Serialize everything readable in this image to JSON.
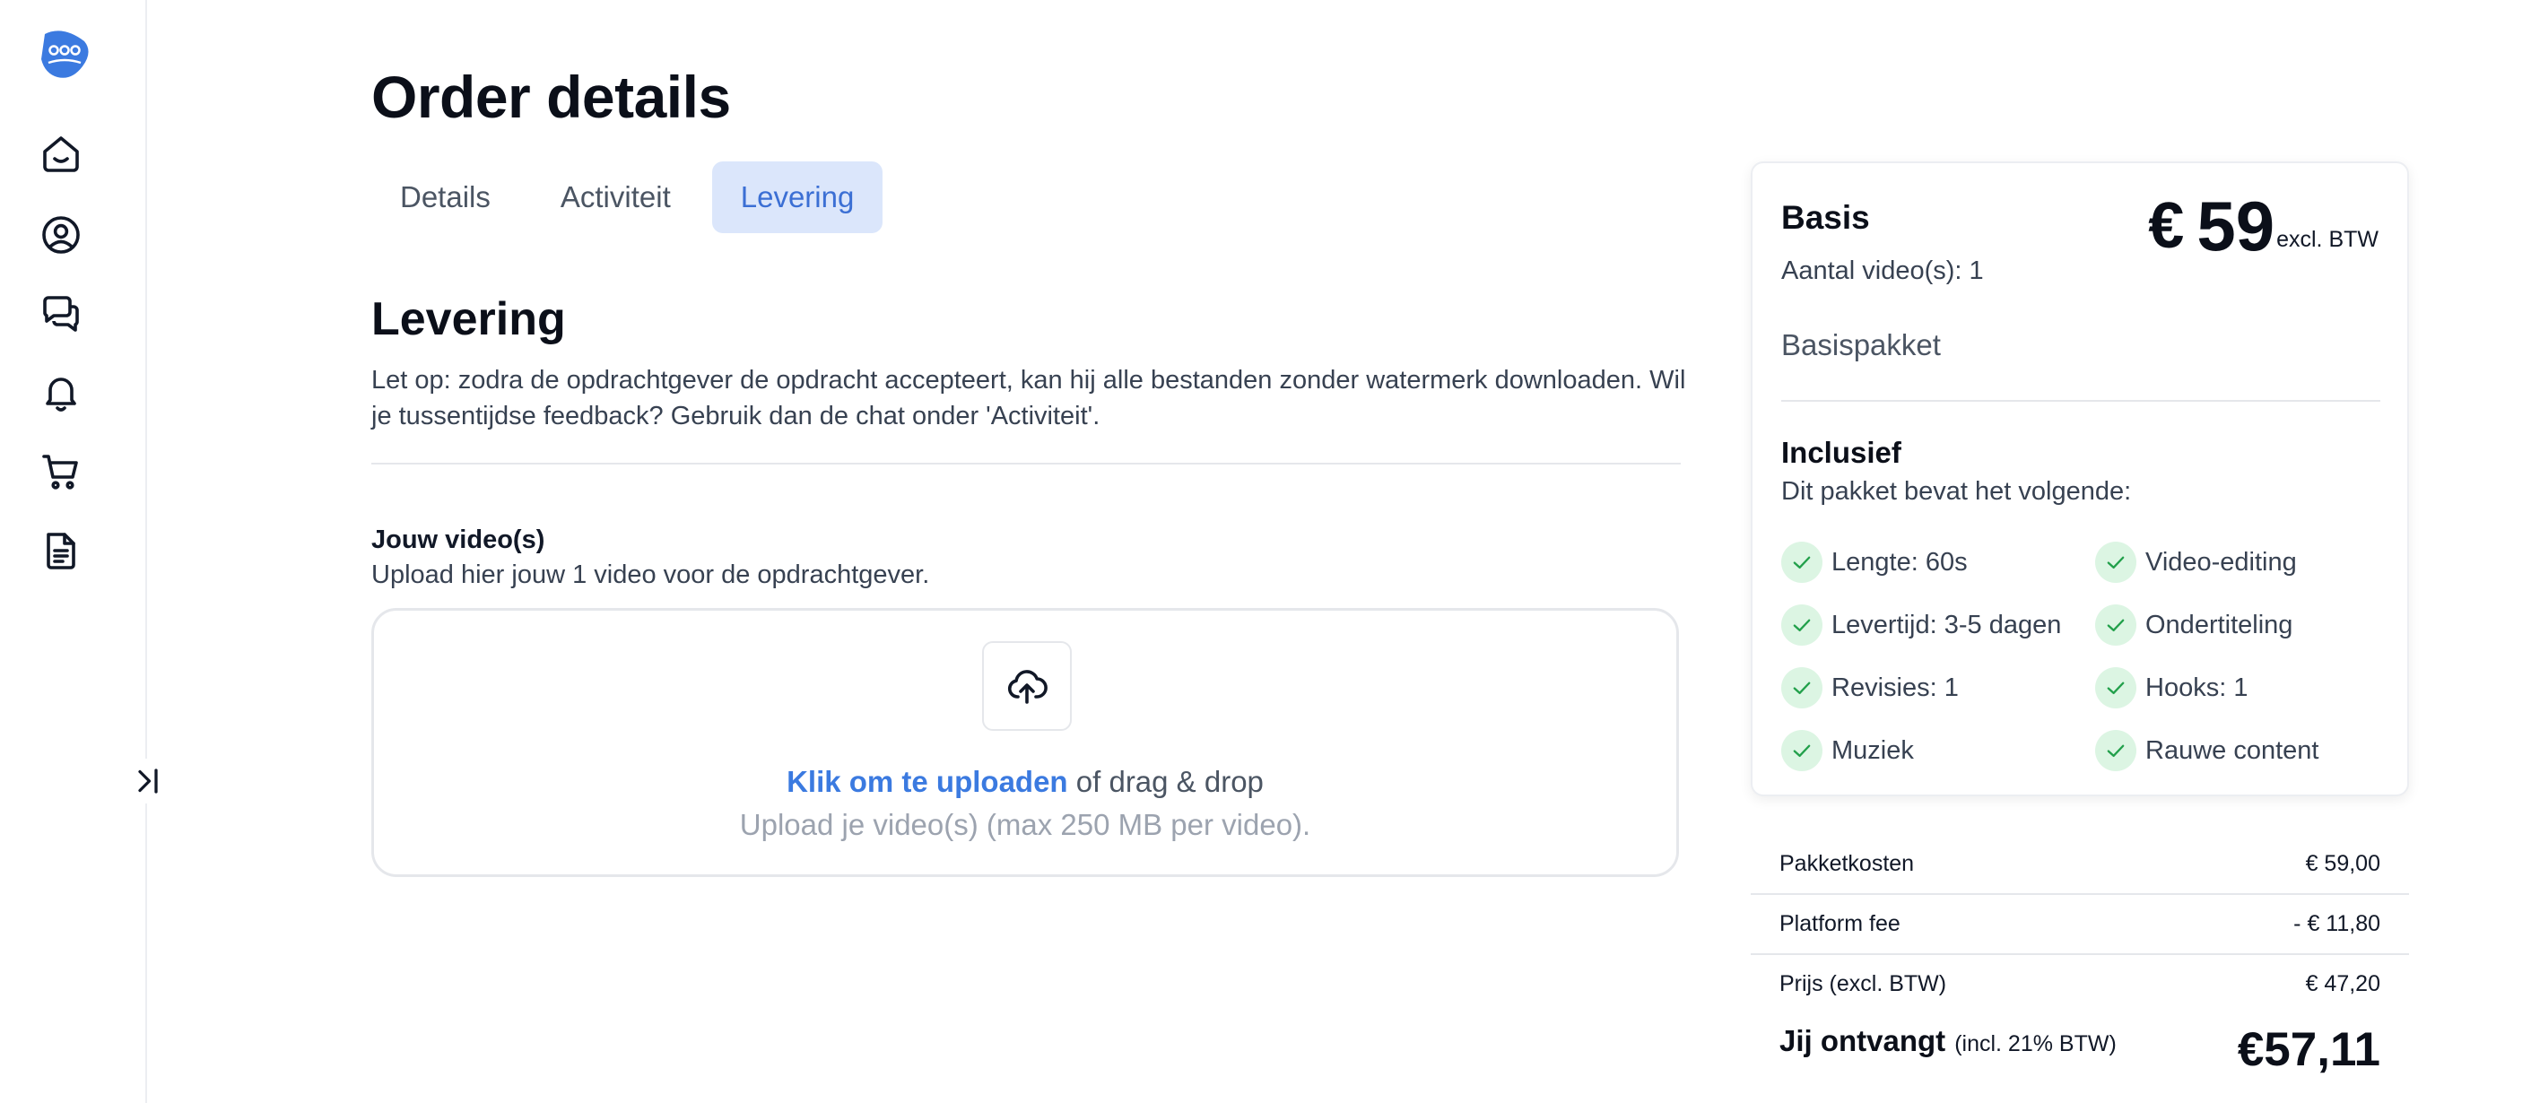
{
  "page": {
    "title": "Order details"
  },
  "tabs": [
    {
      "label": "Details"
    },
    {
      "label": "Activiteit"
    },
    {
      "label": "Levering"
    }
  ],
  "delivery": {
    "title": "Levering",
    "description": "Let op: zodra de opdrachtgever de opdracht accepteert, kan hij alle bestanden zonder watermerk downloaden. Wil je tussentijdse feedback? Gebruik dan de chat onder 'Activiteit'.",
    "videos_label": "Jouw video(s)",
    "videos_sub": "Upload hier jouw 1 video voor de opdrachtgever.",
    "upload_link": "Klik om te uploaden",
    "upload_rest": " of drag & drop",
    "upload_hint": "Upload je video(s) (max 250 MB per video)."
  },
  "package": {
    "name": "Basis",
    "count": "Aantal video(s): 1",
    "currency": "€",
    "price": "59",
    "vat_note": "excl. BTW",
    "type": "Basispakket",
    "included_title": "Inclusief",
    "included_sub": "Dit pakket bevat het volgende:",
    "features": [
      "Lengte: 60s",
      "Video-editing",
      "Levertijd: 3-5 dagen",
      "Ondertiteling",
      "Revisies: 1",
      "Hooks: 1",
      "Muziek",
      "Rauwe content"
    ]
  },
  "summary": {
    "rows": [
      {
        "label": "Pakketkosten",
        "value": "€ 59,00"
      },
      {
        "label": "Platform fee",
        "value": "- € 11,80"
      },
      {
        "label": "Prijs (excl. BTW)",
        "value": "€ 47,20"
      }
    ],
    "receive_label": "Jij ontvangt",
    "receive_note": "(incl. 21% BTW)",
    "receive_total": "€57,11"
  },
  "colors": {
    "accent": "#3b7ae0",
    "tab_active_bg": "#dbe6fb",
    "check_bg": "#dcf5e3",
    "check": "#22a04b"
  },
  "icons": [
    "logo-icon",
    "home-icon",
    "user-circle-icon",
    "chat-icon",
    "bell-icon",
    "cart-icon",
    "document-icon",
    "collapse-sidebar-icon",
    "upload-cloud-icon",
    "check-icon"
  ]
}
